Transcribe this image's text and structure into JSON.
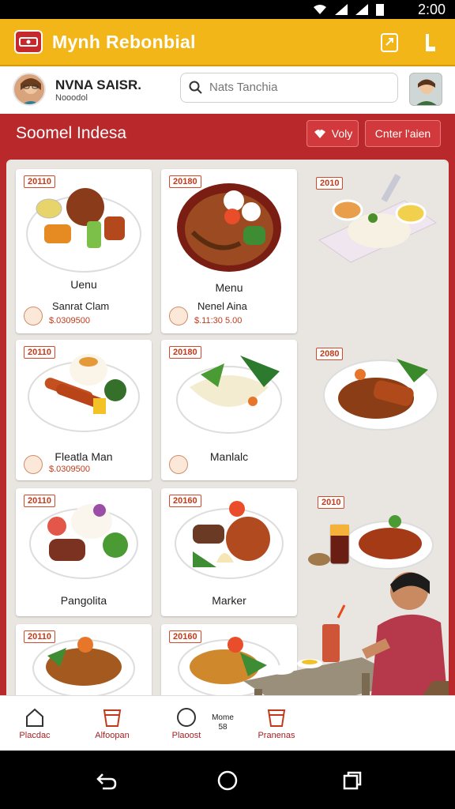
{
  "status_bar": {
    "time": "2:00"
  },
  "app_bar": {
    "title": "Mynh Rebonbial",
    "accent": "#f2b618"
  },
  "profile": {
    "name": "NVNA SAISR.",
    "sub": "Nooodol"
  },
  "search": {
    "placeholder": "Nats Tanchia"
  },
  "section": {
    "title": "Soomel Indesa",
    "button_1": "Voly",
    "button_2": "Cnter l'aien",
    "color": "#b9292c"
  },
  "cards": [
    {
      "badge": "20110",
      "title": "Uenu",
      "sub": "Sanrat Clam",
      "price": "$.0309500"
    },
    {
      "badge": "20180",
      "title": "Menu",
      "sub": "Nenel Aina",
      "price": "$.11:30 5.00"
    },
    {
      "badge": "20110",
      "title": "Fleatla Man",
      "sub": "",
      "price": "$.0309500"
    },
    {
      "badge": "20180",
      "title": "Manlalc",
      "sub": "",
      "price": ""
    },
    {
      "badge": "20110",
      "title": "Pangolita",
      "sub": "",
      "price": ""
    },
    {
      "badge": "20160",
      "title": "Marker",
      "sub": "",
      "price": ""
    },
    {
      "badge": "20110",
      "title": "",
      "sub": "",
      "price": ""
    },
    {
      "badge": "20160",
      "title": "",
      "sub": "",
      "price": ""
    }
  ],
  "floating_badges": [
    "2010",
    "2080",
    "2010"
  ],
  "bottom_nav": {
    "items": [
      "Placdac",
      "Alfoopan",
      "Plaoost",
      "Pranenas"
    ],
    "extra_line_1": "Mome",
    "extra_line_2": "58"
  }
}
